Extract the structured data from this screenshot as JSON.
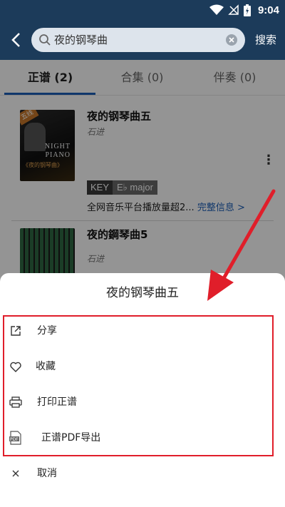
{
  "status_bar": {
    "time": "9:04"
  },
  "search": {
    "query": "夜的钢琴曲",
    "action_label": "搜索"
  },
  "tabs": [
    {
      "label": "正谱 (2)",
      "active": true
    },
    {
      "label": "合集 (0)",
      "active": false
    },
    {
      "label": "伴奏 (0)",
      "active": false
    }
  ],
  "results": [
    {
      "title": "夜的钢琴曲五",
      "artist": "石进",
      "cover_badge": "五线",
      "cover_text_1": "NIGHT",
      "cover_text_2": "PIANO",
      "cover_text_3": "《夜的钢琴曲》",
      "key_label": "KEY",
      "key_value": "E♭ major",
      "description": "全网音乐平台播放量超2...",
      "detail_link": "完整信息 >"
    },
    {
      "title": "夜的鋼琴曲5",
      "artist": "石进"
    }
  ],
  "sheet": {
    "title": "夜的钢琴曲五",
    "items": [
      {
        "label": "分享",
        "icon": "share-icon"
      },
      {
        "label": "收藏",
        "icon": "heart-icon"
      },
      {
        "label": "打印正谱",
        "icon": "printer-icon"
      },
      {
        "label": "正谱PDF导出",
        "icon": "pdf-icon"
      },
      {
        "label": "取消",
        "icon": "close-icon"
      }
    ]
  },
  "colors": {
    "toolbar": "#1c3b5a",
    "accent": "#1c5fb8",
    "annotation": "#e01e2a"
  }
}
